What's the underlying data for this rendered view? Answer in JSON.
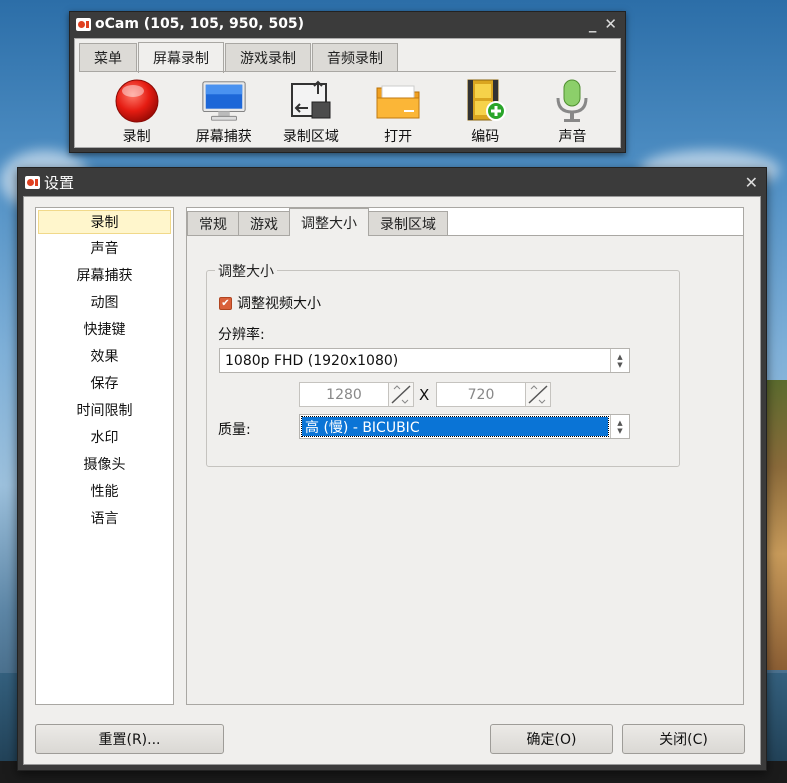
{
  "ocam": {
    "title": "oCam (105, 105, 950, 505)",
    "tabs": [
      "菜单",
      "屏幕录制",
      "游戏录制",
      "音频录制"
    ],
    "active_tab": 1,
    "tools": [
      {
        "label": "录制",
        "icon": "record-icon"
      },
      {
        "label": "屏幕捕获",
        "icon": "monitor-icon"
      },
      {
        "label": "录制区域",
        "icon": "resize-area-icon"
      },
      {
        "label": "打开",
        "icon": "folder-icon"
      },
      {
        "label": "编码",
        "icon": "film-add-icon"
      },
      {
        "label": "声音",
        "icon": "microphone-icon"
      }
    ]
  },
  "settings": {
    "title": "设置",
    "nav": [
      "录制",
      "声音",
      "屏幕捕获",
      "动图",
      "快捷键",
      "效果",
      "保存",
      "时间限制",
      "水印",
      "摄像头",
      "性能",
      "语言"
    ],
    "active_nav": 0,
    "tabs": [
      "常规",
      "游戏",
      "调整大小",
      "录制区域"
    ],
    "active_tab": 2,
    "resize": {
      "group_title": "调整大小",
      "checkbox_label": "调整视频大小",
      "checkbox_checked": true,
      "resolution_label": "分辨率:",
      "resolution_value": "1080p FHD (1920x1080)",
      "width_value": "1280",
      "height_value": "720",
      "x_label": "X",
      "quality_label": "质量:",
      "quality_value": "高 (慢) - BICUBIC"
    },
    "buttons": {
      "reset": "重置(R)...",
      "ok": "确定(O)",
      "close": "关闭(C)"
    }
  }
}
